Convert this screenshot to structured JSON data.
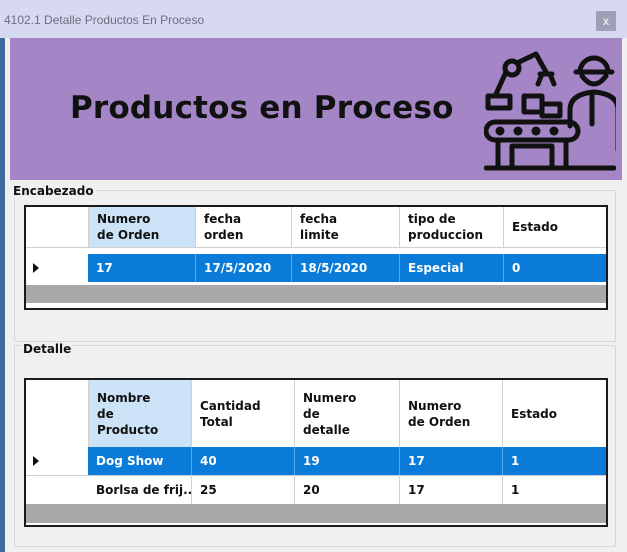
{
  "window": {
    "title": "4102.1 Detalle Productos En Proceso",
    "close_label": "x"
  },
  "banner": {
    "heading": "Productos en Proceso",
    "icon": "factory-worker-robot-arm-icon",
    "color": "#a486c6"
  },
  "encabezado": {
    "label": "Encabezado",
    "columns": [
      "Numero\nde Orden",
      "fecha\norden",
      "fecha\nlimite",
      "tipo de\nproduccion",
      "Estado"
    ],
    "rows": [
      {
        "selected": true,
        "cells": [
          "17",
          "17/5/2020",
          "18/5/2020",
          "Especial",
          "0"
        ]
      }
    ]
  },
  "detalle": {
    "label": "Detalle",
    "columns": [
      "Nombre\nde\nProducto",
      "Cantidad\nTotal",
      "Numero\nde\ndetalle",
      "Numero\nde Orden",
      "Estado"
    ],
    "rows": [
      {
        "selected": true,
        "cells": [
          "Dog Show",
          "40",
          "19",
          "17",
          "1"
        ]
      },
      {
        "selected": false,
        "cells": [
          "Borlsa de frij...",
          "25",
          "20",
          "17",
          "1"
        ]
      }
    ]
  },
  "colors": {
    "selection": "#0a7bd8",
    "header_selected": "#cce3f7",
    "titlebar": "#d7d9f0"
  }
}
